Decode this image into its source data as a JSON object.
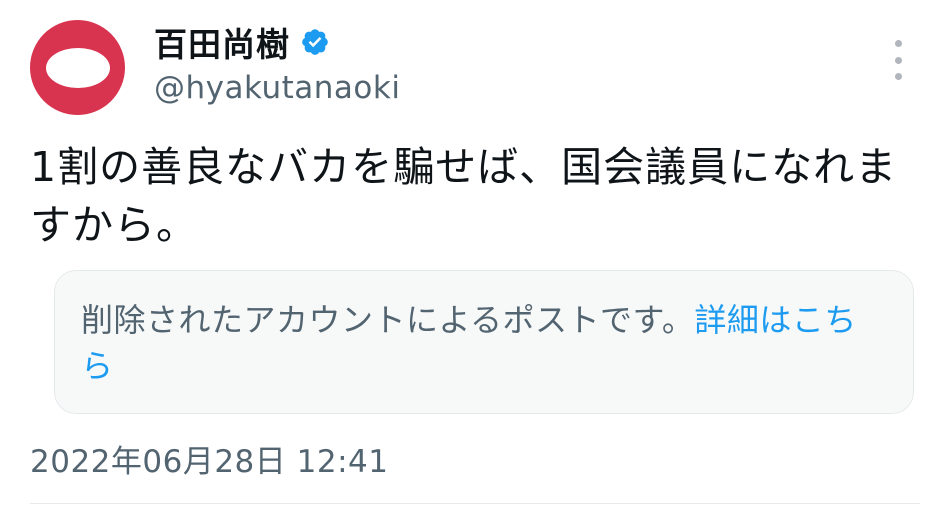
{
  "author": {
    "display_name": "百田尚樹",
    "handle": "@hyakutanaoki",
    "verified": true,
    "avatar_color": "#d9344f"
  },
  "tweet": {
    "text": "1割の善良なバカを騙せば、国会議員になれますから。",
    "timestamp": "2022年06月28日 12:41"
  },
  "notice": {
    "text": "削除されたアカウントによるポストです。",
    "link_text": "詳細はこちら"
  },
  "icons": {
    "verified": "verified-badge-icon",
    "more": "more-options-icon"
  },
  "colors": {
    "link": "#1d9bf0",
    "secondary_text": "#536471",
    "verified": "#1d9bf0"
  }
}
